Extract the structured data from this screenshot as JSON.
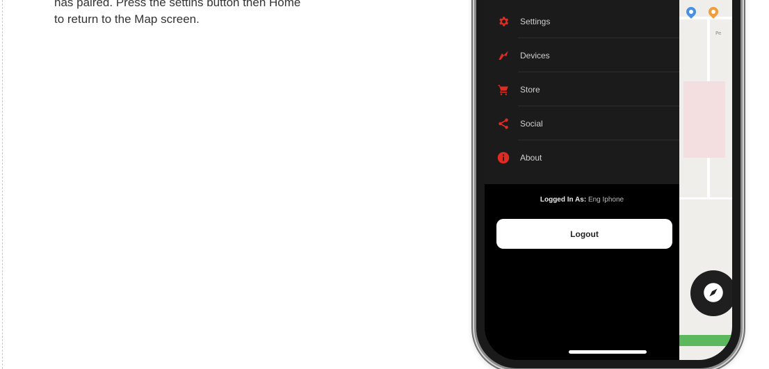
{
  "instructions": {
    "line1": "has paired. Press the settins button then Home",
    "line2": "to return to the Map screen."
  },
  "drawer": {
    "items": [
      {
        "label": "Settings",
        "icon": "gear-icon"
      },
      {
        "label": "Devices",
        "icon": "device-icon"
      },
      {
        "label": "Store",
        "icon": "cart-icon"
      },
      {
        "label": "Social",
        "icon": "share-icon"
      },
      {
        "label": "About",
        "icon": "info-icon"
      }
    ],
    "logged_in_prefix": "Logged In As:",
    "logged_in_user": "Eng Iphone",
    "logout_label": "Logout"
  },
  "map": {
    "road_label": "Pe"
  },
  "colors": {
    "accent": "#e02b22",
    "drawer_bg": "#1b1b1b",
    "screen_bg": "#000000",
    "button_bg": "#ffffff",
    "map_bg": "#efeeea",
    "green_bar": "#5cb85c",
    "pin_blue": "#4a90e2",
    "pin_orange": "#f39c3a"
  }
}
